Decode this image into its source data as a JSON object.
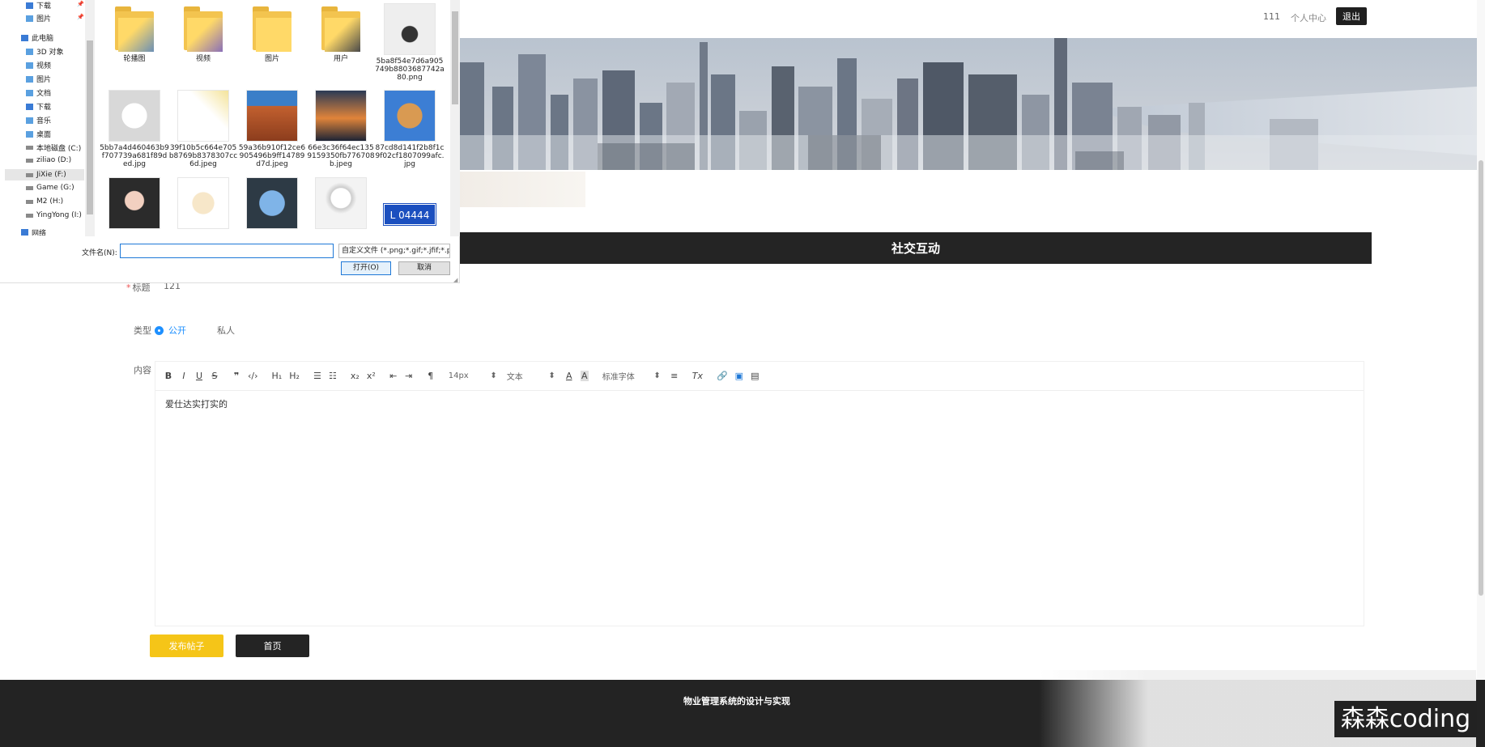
{
  "header": {
    "user": "111",
    "center_link": "个人中心",
    "logout": "退出"
  },
  "section": {
    "title": "社交互动"
  },
  "form": {
    "title_label": "标题",
    "title_value": "121",
    "type_label": "类型",
    "type_options": [
      "公开",
      "私人"
    ],
    "type_selected": "公开",
    "content_label": "内容",
    "content_value": "爱仕达实打实的",
    "toolbar": {
      "size": "14px",
      "format": "文本",
      "font": "标准字体"
    },
    "submit": "发布帖子",
    "home": "首页"
  },
  "footer": {
    "text": "物业管理系统的设计与实现"
  },
  "watermark": "森森coding",
  "dialog": {
    "nav": [
      {
        "label": "下载",
        "pinned": true
      },
      {
        "label": "图片",
        "pinned": true
      },
      {
        "label": "此电脑"
      },
      {
        "label": "3D 对象"
      },
      {
        "label": "视频"
      },
      {
        "label": "图片"
      },
      {
        "label": "文档"
      },
      {
        "label": "下载"
      },
      {
        "label": "音乐"
      },
      {
        "label": "桌面"
      },
      {
        "label": "本地磁盘 (C:)"
      },
      {
        "label": "ziliao (D:)"
      },
      {
        "label": "JiXie (F:)",
        "selected": true
      },
      {
        "label": "Game (G:)"
      },
      {
        "label": "M2 (H:)"
      },
      {
        "label": "YingYong (I:)"
      },
      {
        "label": "网络"
      }
    ],
    "files": [
      {
        "name": "轮播图",
        "kind": "folder"
      },
      {
        "name": "视频",
        "kind": "folder"
      },
      {
        "name": "图片",
        "kind": "folder"
      },
      {
        "name": "用户",
        "kind": "folder"
      },
      {
        "name": "5ba8f54e7d6a905749b8803687742a80.png",
        "kind": "image"
      },
      {
        "name": "5bb7a4d460463b9f707739a681f89ded.jpg",
        "kind": "image"
      },
      {
        "name": "39f10b5c664e705b8769b8378307cc6d.jpeg",
        "kind": "image"
      },
      {
        "name": "59a36b910f12ce6905496b9ff14789d7d.jpeg",
        "kind": "image"
      },
      {
        "name": "66e3c36f64ec1359159350fb776708b.jpeg",
        "kind": "image"
      },
      {
        "name": "87cd8d141f2b8f1c9f02cf1807099afc.jpg",
        "kind": "image"
      },
      {
        "name": "",
        "kind": "image"
      },
      {
        "name": "",
        "kind": "image"
      },
      {
        "name": "",
        "kind": "image"
      },
      {
        "name": "",
        "kind": "image"
      },
      {
        "name": "L 04444",
        "kind": "image"
      }
    ],
    "filename_label": "文件名(N):",
    "filename_value": "",
    "filetype": "自定义文件 (*.png;*.gif;*.jfif;*.p",
    "open": "打开(O)",
    "cancel": "取消"
  }
}
